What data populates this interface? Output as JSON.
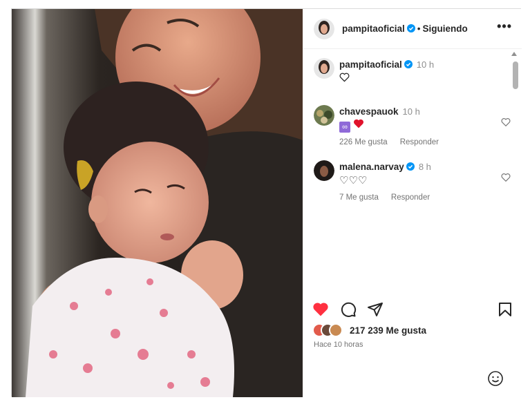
{
  "header": {
    "username": "pampitaoficial",
    "separator": "•",
    "follow_status": "Siguiendo",
    "more_label": "•••"
  },
  "comments": [
    {
      "username": "pampitaoficial",
      "verified": true,
      "time": "10 h",
      "body": "",
      "likes": "",
      "reply": ""
    },
    {
      "username": "chavespauok",
      "verified": false,
      "time": "10 h",
      "body": "♾️❤️",
      "likes": "226 Me gusta",
      "reply": "Responder"
    },
    {
      "username": "malena.narvay",
      "verified": true,
      "time": "8 h",
      "body": "♡♡♡",
      "likes": "7 Me gusta",
      "reply": "Responder"
    }
  ],
  "footer": {
    "likes": "217 239 Me gusta",
    "time_ago": "Hace 10 horas"
  },
  "colors": {
    "accent": "#0095f6",
    "like_red": "#ff3040",
    "text": "#262626",
    "muted": "#737373"
  },
  "icons": [
    "verified-badge-icon",
    "heart-icon",
    "comment-icon",
    "share-icon",
    "bookmark-icon",
    "emoji-icon",
    "more-icon"
  ]
}
